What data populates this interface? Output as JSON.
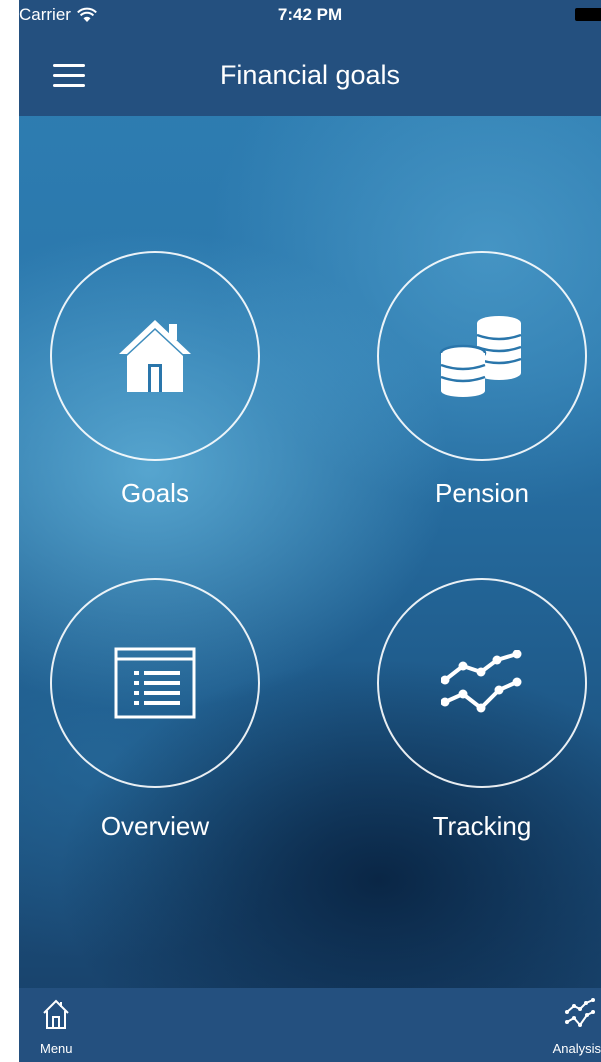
{
  "status_bar": {
    "carrier": "Carrier",
    "time": "7:42 PM"
  },
  "nav": {
    "title": "Financial goals",
    "menu_icon": "hamburger-menu-icon"
  },
  "tiles": [
    {
      "label": "Goals",
      "icon": "house-icon"
    },
    {
      "label": "Pension",
      "icon": "coins-stack-icon"
    },
    {
      "label": "Overview",
      "icon": "document-list-icon"
    },
    {
      "label": "Tracking",
      "icon": "trend-lines-icon"
    }
  ],
  "tab_bar": {
    "items": [
      {
        "label": "Menu",
        "icon": "home-outline-icon"
      },
      {
        "label": "Analysis",
        "icon": "analysis-chart-icon"
      }
    ]
  },
  "colors": {
    "bar": "#24507f",
    "text": "#ffffff"
  }
}
